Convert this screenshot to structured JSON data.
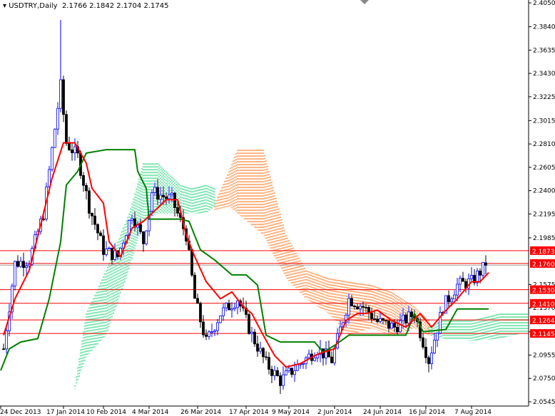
{
  "chart_data": {
    "type": "candlestick",
    "title": "USDTRY,Daily",
    "ohlc_header": "2.1766 2.1842 2.1704 2.1745",
    "ylim": [
      2.0545,
      2.405
    ],
    "y_ticks": [
      "2.4050",
      "2.3840",
      "2.3635",
      "2.3430",
      "2.3225",
      "2.3015",
      "2.2810",
      "2.2605",
      "2.2400",
      "2.2195",
      "2.1985",
      "2.1575",
      "2.1370",
      "2.1160",
      "2.0955",
      "2.0750",
      "2.0545"
    ],
    "x_ticks": [
      {
        "bar": -1,
        "label": "24 Dec 2013"
      },
      {
        "bar": 21,
        "label": "17 Jan 2014"
      },
      {
        "bar": 35,
        "label": "10 Feb 2014"
      },
      {
        "bar": 51,
        "label": "4 Mar 2014"
      },
      {
        "bar": 68,
        "label": "26 Mar 2014"
      },
      {
        "bar": 85,
        "label": "17 Apr 2014"
      },
      {
        "bar": 100,
        "label": "9 May 2014"
      },
      {
        "bar": 116,
        "label": "2 Jun 2014"
      },
      {
        "bar": 132,
        "label": "24 Jun 2014"
      },
      {
        "bar": 148,
        "label": "16 Jul 2014"
      },
      {
        "bar": 164,
        "label": "7 Aug 2014"
      }
    ],
    "close_anchors": [
      [
        0,
        2.101
      ],
      [
        4,
        2.176
      ],
      [
        9,
        2.179
      ],
      [
        14,
        2.22
      ],
      [
        17,
        2.276
      ],
      [
        20,
        2.332
      ],
      [
        22,
        2.282
      ],
      [
        26,
        2.27
      ],
      [
        30,
        2.226
      ],
      [
        35,
        2.188
      ],
      [
        40,
        2.182
      ],
      [
        45,
        2.22
      ],
      [
        49,
        2.195
      ],
      [
        52,
        2.239
      ],
      [
        59,
        2.232
      ],
      [
        64,
        2.201
      ],
      [
        67,
        2.145
      ],
      [
        71,
        2.107
      ],
      [
        76,
        2.132
      ],
      [
        82,
        2.145
      ],
      [
        87,
        2.113
      ],
      [
        92,
        2.088
      ],
      [
        97,
        2.073
      ],
      [
        104,
        2.088
      ],
      [
        110,
        2.101
      ],
      [
        115,
        2.091
      ],
      [
        121,
        2.145
      ],
      [
        126,
        2.138
      ],
      [
        131,
        2.125
      ],
      [
        137,
        2.12
      ],
      [
        144,
        2.132
      ],
      [
        149,
        2.091
      ],
      [
        154,
        2.138
      ],
      [
        159,
        2.157
      ],
      [
        164,
        2.16
      ],
      [
        169,
        2.1745
      ]
    ],
    "tenkan_sen": [
      [
        0,
        2.113
      ],
      [
        4,
        2.145
      ],
      [
        9,
        2.17
      ],
      [
        14,
        2.22
      ],
      [
        17,
        2.251
      ],
      [
        21,
        2.282
      ],
      [
        25,
        2.282
      ],
      [
        29,
        2.264
      ],
      [
        31,
        2.242
      ],
      [
        35,
        2.229
      ],
      [
        37,
        2.195
      ],
      [
        41,
        2.182
      ],
      [
        45,
        2.207
      ],
      [
        49,
        2.213
      ],
      [
        52,
        2.22
      ],
      [
        57,
        2.232
      ],
      [
        61,
        2.232
      ],
      [
        64,
        2.201
      ],
      [
        67,
        2.182
      ],
      [
        71,
        2.16
      ],
      [
        76,
        2.145
      ],
      [
        80,
        2.151
      ],
      [
        84,
        2.138
      ],
      [
        87,
        2.132
      ],
      [
        91,
        2.113
      ],
      [
        95,
        2.095
      ],
      [
        99,
        2.085
      ],
      [
        104,
        2.088
      ],
      [
        109,
        2.095
      ],
      [
        112,
        2.098
      ],
      [
        116,
        2.101
      ],
      [
        120,
        2.126
      ],
      [
        124,
        2.132
      ],
      [
        127,
        2.132
      ],
      [
        131,
        2.135
      ],
      [
        136,
        2.126
      ],
      [
        141,
        2.12
      ],
      [
        146,
        2.132
      ],
      [
        150,
        2.12
      ],
      [
        154,
        2.132
      ],
      [
        159,
        2.145
      ],
      [
        164,
        2.16
      ],
      [
        167,
        2.16
      ],
      [
        170,
        2.168
      ]
    ],
    "kijun_sen": [
      [
        -1,
        2.082
      ],
      [
        2,
        2.101
      ],
      [
        6,
        2.107
      ],
      [
        12,
        2.11
      ],
      [
        16,
        2.145
      ],
      [
        20,
        2.195
      ],
      [
        22,
        2.245
      ],
      [
        26,
        2.257
      ],
      [
        29,
        2.273
      ],
      [
        36,
        2.276
      ],
      [
        46,
        2.276
      ],
      [
        47,
        2.257
      ],
      [
        50,
        2.242
      ],
      [
        51,
        2.215
      ],
      [
        62,
        2.215
      ],
      [
        65,
        2.213
      ],
      [
        69,
        2.188
      ],
      [
        74,
        2.179
      ],
      [
        80,
        2.166
      ],
      [
        85,
        2.166
      ],
      [
        89,
        2.157
      ],
      [
        92,
        2.113
      ],
      [
        97,
        2.107
      ],
      [
        109,
        2.107
      ],
      [
        112,
        2.098
      ],
      [
        116,
        2.104
      ],
      [
        121,
        2.113
      ],
      [
        141,
        2.113
      ],
      [
        144,
        2.132
      ],
      [
        147,
        2.116
      ],
      [
        155,
        2.118
      ],
      [
        159,
        2.136
      ],
      [
        170,
        2.136
      ]
    ],
    "cloud_bearish": [
      [
        74,
        2.229,
        2.223
      ],
      [
        79,
        2.257,
        2.226
      ],
      [
        82,
        2.276,
        2.22
      ],
      [
        91,
        2.276,
        2.201
      ],
      [
        99,
        2.201,
        2.163
      ],
      [
        106,
        2.17,
        2.145
      ],
      [
        114,
        2.163,
        2.132
      ],
      [
        121,
        2.16,
        2.113
      ],
      [
        129,
        2.157,
        2.119
      ],
      [
        136,
        2.151,
        2.113
      ],
      [
        144,
        2.138,
        2.119
      ],
      [
        149,
        2.126,
        2.113
      ]
    ],
    "cloud_bullish": [
      [
        [
          25,
          2.069,
          2.066
        ],
        [
          29,
          2.132,
          2.094
        ],
        [
          36,
          2.17,
          2.113
        ],
        [
          44,
          2.22,
          2.17
        ],
        [
          49,
          2.264,
          2.213
        ],
        [
          54,
          2.264,
          2.22
        ],
        [
          62,
          2.245,
          2.22
        ],
        [
          66,
          2.242,
          2.22
        ],
        [
          71,
          2.245,
          2.22
        ],
        [
          74,
          2.242,
          2.226
        ]
      ],
      [
        [
          149,
          2.12,
          2.113
        ],
        [
          154,
          2.126,
          2.11
        ],
        [
          164,
          2.126,
          2.108
        ],
        [
          174,
          2.132,
          2.11
        ],
        [
          184,
          2.132,
          2.116
        ]
      ]
    ],
    "levels": [
      "2.1873",
      "2.1760",
      "2.1530",
      "2.1410",
      "2.1264",
      "2.1145"
    ],
    "current_price": 2.1745
  },
  "colors": {
    "bull": "#0000ff",
    "bear": "#000000",
    "tenkan": "#ff0000",
    "kijun": "#008000",
    "cloud_bear": "#ff6600",
    "cloud_bull": "#00cc66",
    "level": "#ff0000"
  }
}
